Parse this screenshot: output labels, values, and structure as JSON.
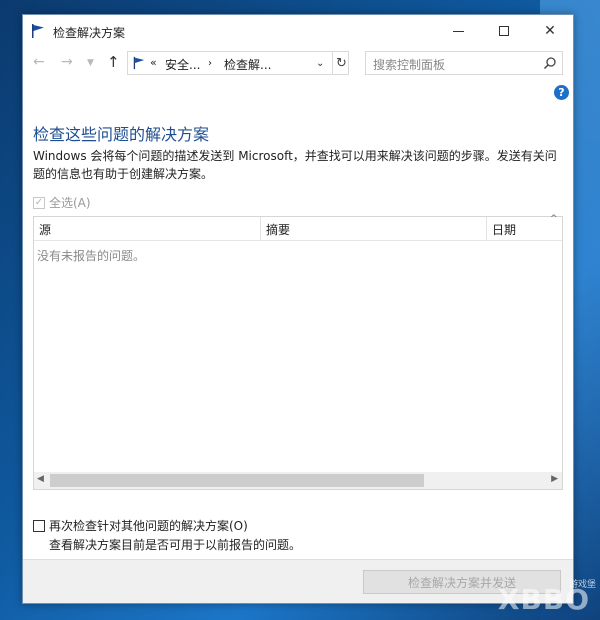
{
  "window": {
    "title": "检查解决方案"
  },
  "nav": {
    "address_prefix": "«",
    "crumb1": "安全...",
    "crumb_sep": "›",
    "crumb2": "检查解...",
    "search_placeholder": "搜索控制面板"
  },
  "content": {
    "heading": "检查这些问题的解决方案",
    "description": "Windows 会将每个问题的描述发送到 Microsoft，并查找可以用来解决该问题的步骤。发送有关问题的信息也有助于创建解决方案。",
    "select_all_label": "全选(A)",
    "columns": [
      "源",
      "摘要",
      "日期"
    ],
    "empty_message": "没有未报告的问题。",
    "recheck_label": "再次检查针对其他问题的解决方案(O)",
    "recheck_sub": "查看解决方案目前是否可用于以前报告的问题。"
  },
  "footer": {
    "button_label": "检查解决方案并发送"
  },
  "watermark": {
    "text": "XBBO",
    "sub": "游戏堡"
  },
  "colors": {
    "heading": "#1e4e91",
    "accent": "#1e6fc8",
    "desktop": "#0f5aa0"
  }
}
